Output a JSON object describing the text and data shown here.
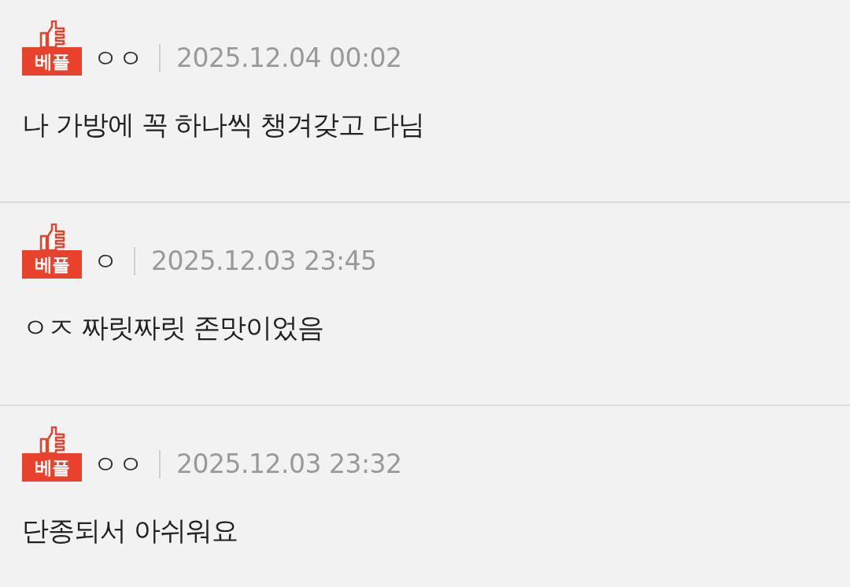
{
  "comments": [
    {
      "badge": "베플",
      "author": "ㅇㅇ",
      "date": "2025.12.04 00:02",
      "text": "나 가방에 꼭 하나씩 챙겨갖고 다님"
    },
    {
      "badge": "베플",
      "author": "ㅇ",
      "date": "2025.12.03 23:45",
      "text": "ㅇㅈ 짜릿짜릿 존맛이었음"
    },
    {
      "badge": "베플",
      "author": "ㅇㅇ",
      "date": "2025.12.03 23:32",
      "text": "단종되서 아쉬워요"
    }
  ]
}
